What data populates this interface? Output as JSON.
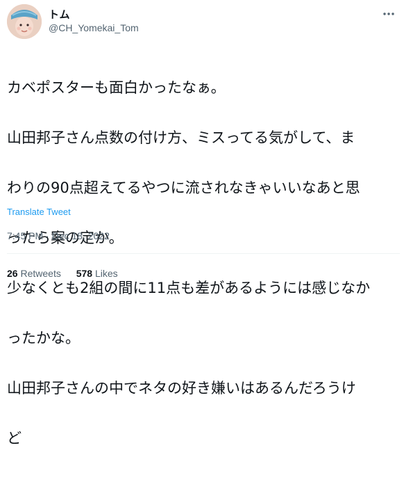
{
  "author": {
    "name": "トム",
    "handle": "@CH_Yomekai_Tom"
  },
  "tweet": {
    "lines": [
      "カベポスターも面白かったなぁ。",
      "山田邦子さん点数の付け方、ミスってる気がして、ま",
      "わりの90点超えてるやつに流されなきゃいいなあと思",
      "ったら案の定か。",
      "少なくとも2組の間に11点も差があるようには感じなか",
      "ったかな。",
      "山田邦子さんの中でネタの好き嫌いはあるんだろうけ",
      "ど"
    ],
    "translate_label": "Translate Tweet",
    "timestamp": "7:45 PM · Dec 18, 2022"
  },
  "stats": {
    "retweets_count": "26",
    "retweets_label": "Retweets",
    "likes_count": "578",
    "likes_label": "Likes"
  },
  "icons": {
    "more": "more-options-icon",
    "avatar": "profile-photo"
  },
  "colors": {
    "link": "#1d9bf0",
    "secondary_text": "#536471",
    "primary_text": "#0f1419"
  }
}
